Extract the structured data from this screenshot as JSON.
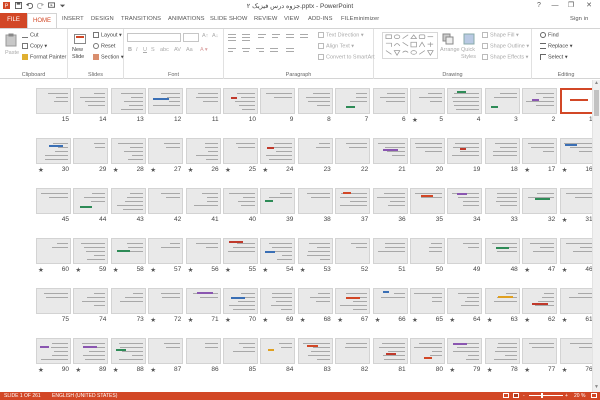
{
  "window": {
    "title": "جزوه درس فیزیک ۲.pptx - PowerPoint",
    "signin": "Sign in",
    "help": "?",
    "minimize": "—",
    "restore": "❐",
    "close": "✕"
  },
  "tabs": [
    "FILE",
    "HOME",
    "INSERT",
    "DESIGN",
    "TRANSITIONS",
    "ANIMATIONS",
    "SLIDE SHOW",
    "REVIEW",
    "VIEW",
    "ADD-INS",
    "FILEminimizer"
  ],
  "ribbon": {
    "clipboard": {
      "paste": "Paste",
      "cut": "Cut",
      "copy": "Copy",
      "format_painter": "Format Painter",
      "label": "Clipboard"
    },
    "slides": {
      "new_slide": "New Slide",
      "layout": "Layout",
      "reset": "Reset",
      "section": "Section",
      "label": "Slides"
    },
    "font": {
      "label": "Font",
      "bold": "B",
      "italic": "I",
      "underline": "U",
      "strike": "S",
      "aa": "Aa"
    },
    "paragraph": {
      "text_direction": "Text Direction",
      "align_text": "Align Text",
      "convert_smartart": "Convert to SmartArt",
      "label": "Paragraph"
    },
    "drawing": {
      "arrange": "Arrange",
      "quick_styles": "Quick Styles",
      "shape_fill": "Shape Fill",
      "shape_outline": "Shape Outline",
      "shape_effects": "Shape Effects",
      "label": "Drawing"
    },
    "editing": {
      "find": "Find",
      "replace": "Replace",
      "select": "Select",
      "label": "Editing"
    }
  },
  "slides": {
    "rows": [
      {
        "numbers": [
          15,
          14,
          13,
          12,
          11,
          10,
          9,
          8,
          7,
          6,
          5,
          4,
          3,
          2,
          1
        ],
        "starred": [
          5
        ],
        "selected": 1
      },
      {
        "numbers": [
          30,
          29,
          28,
          27,
          26,
          25,
          24,
          23,
          22,
          21,
          20,
          19,
          18,
          17,
          16
        ],
        "starred": [
          30,
          28,
          27,
          26,
          25,
          24,
          17,
          16
        ]
      },
      {
        "numbers": [
          45,
          44,
          43,
          42,
          41,
          40,
          39,
          38,
          37,
          36,
          35,
          34,
          33,
          32,
          31
        ],
        "starred": [
          31
        ]
      },
      {
        "numbers": [
          60,
          59,
          58,
          57,
          56,
          55,
          54,
          53,
          52,
          51,
          50,
          49,
          48,
          47,
          46
        ],
        "starred": [
          60,
          59,
          58,
          57,
          56,
          55,
          54,
          53,
          47,
          46
        ]
      },
      {
        "numbers": [
          75,
          74,
          73,
          72,
          71,
          70,
          69,
          68,
          67,
          66,
          65,
          64,
          63,
          62,
          61
        ],
        "starred": [
          72,
          71,
          70,
          69,
          68,
          67,
          66,
          65,
          64,
          63,
          62,
          61
        ]
      },
      {
        "numbers": [
          90,
          89,
          88,
          87,
          86,
          85,
          84,
          83,
          82,
          81,
          80,
          79,
          78,
          77,
          76
        ],
        "starred": [
          90,
          89,
          88,
          87,
          79,
          78,
          77,
          76
        ]
      }
    ]
  },
  "status": {
    "slide_of": "SLIDE 1 OF 261",
    "language": "ENGLISH (UNITED STATES)",
    "zoom": "20 %",
    "zoom_minus": "-",
    "zoom_plus": "+"
  },
  "colors": {
    "accent": "#d24726"
  }
}
